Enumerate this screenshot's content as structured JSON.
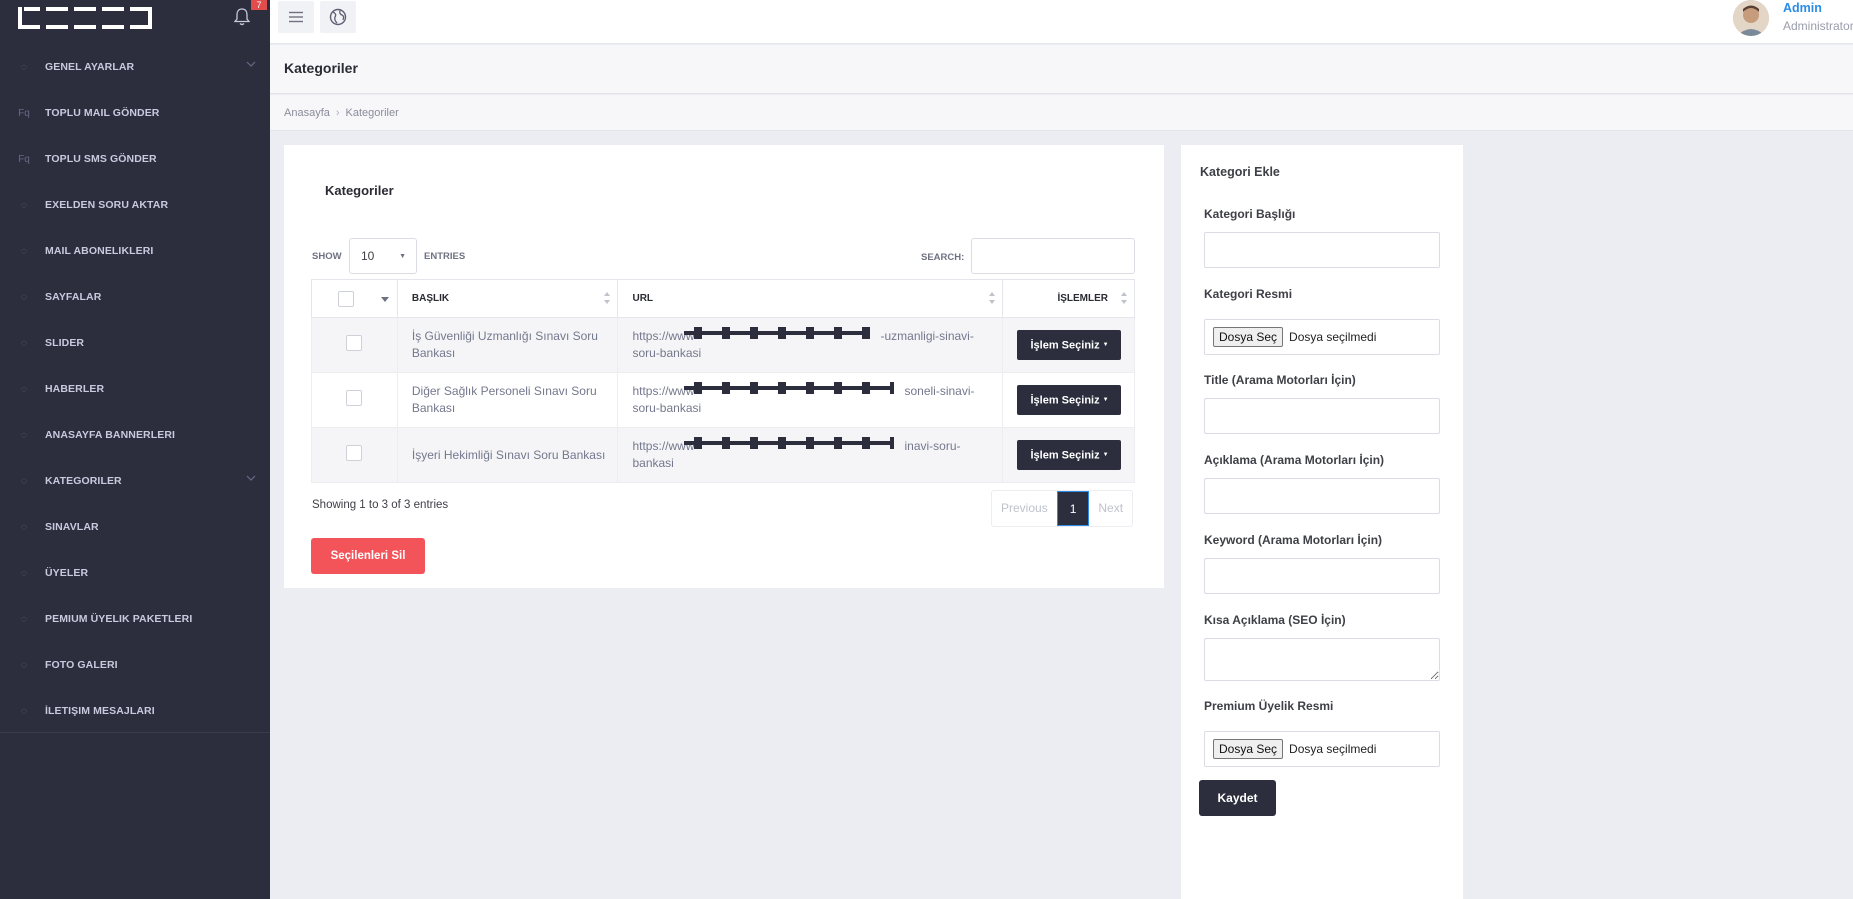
{
  "notifications": {
    "count": "7"
  },
  "sidebar": {
    "items": [
      {
        "label": "GENEL AYARLAR",
        "icon": "circle-icon",
        "glyph": "◌",
        "has_submenu": true
      },
      {
        "label": "TOPLU MAIL GÖNDER",
        "icon": "fq-icon",
        "glyph": "Fq",
        "has_submenu": false
      },
      {
        "label": "TOPLU SMS GÖNDER",
        "icon": "fq-icon",
        "glyph": "Fq",
        "has_submenu": false
      },
      {
        "label": "EXELDEN SORU AKTAR",
        "icon": "circle-icon",
        "glyph": "◌",
        "has_submenu": false
      },
      {
        "label": "MAIL ABONELIKLERI",
        "icon": "circle-icon",
        "glyph": "◌",
        "has_submenu": false
      },
      {
        "label": "SAYFALAR",
        "icon": "circle-icon",
        "glyph": "◌",
        "has_submenu": false
      },
      {
        "label": "SLIDER",
        "icon": "circle-icon",
        "glyph": "◌",
        "has_submenu": false
      },
      {
        "label": "HABERLER",
        "icon": "circle-icon",
        "glyph": "◌",
        "has_submenu": false
      },
      {
        "label": "ANASAYFA BANNERLERI",
        "icon": "circle-icon",
        "glyph": "◌",
        "has_submenu": false
      },
      {
        "label": "KATEGORILER",
        "icon": "circle-icon",
        "glyph": "◌",
        "has_submenu": true
      },
      {
        "label": "SINAVLAR",
        "icon": "circle-icon",
        "glyph": "◌",
        "has_submenu": false
      },
      {
        "label": "ÜYELER",
        "icon": "circle-icon",
        "glyph": "◌",
        "has_submenu": false
      },
      {
        "label": "PEMIUM ÜYELIK PAKETLERI",
        "icon": "circle-icon",
        "glyph": "◌",
        "has_submenu": false
      },
      {
        "label": "FOTO GALERI",
        "icon": "circle-icon",
        "glyph": "◌",
        "has_submenu": false
      },
      {
        "label": "İLETIŞIM MESAJLARI",
        "icon": "circle-icon",
        "glyph": "◌",
        "has_submenu": false
      }
    ]
  },
  "user": {
    "name": "Admin",
    "role": "Administrator"
  },
  "page": {
    "title": "Kategoriler"
  },
  "breadcrumb": {
    "home": "Anasayfa",
    "sep": "›",
    "current": "Kategoriler"
  },
  "card": {
    "title": "Kategoriler",
    "show_label": "SHOW",
    "entries_value": "10",
    "entries_label": "ENTRIES",
    "search_label": "SEARCH:",
    "search_value": ""
  },
  "table": {
    "columns": {
      "title": "BAŞLIK",
      "url": "URL",
      "actions": "İŞLEMLER"
    },
    "rows": [
      {
        "title": "İş Güvenliği Uzmanlığı Sınavı Soru Bankası",
        "url_prefix": "https://www",
        "url_suffix": "-uzmanligi-sinavi-soru-bankasi",
        "action": "İşlem Seçiniz"
      },
      {
        "title": "Diğer Sağlık Personeli Sınavı Soru Bankası",
        "url_prefix": "https://www",
        "url_suffix": "soneli-sinavi-soru-bankasi",
        "action": "İşlem Seçiniz"
      },
      {
        "title": "İşyeri Hekimliği Sınavı Soru Bankası",
        "url_prefix": "https://www",
        "url_suffix": "inavi-soru-bankasi",
        "action": "İşlem Seçiniz"
      }
    ]
  },
  "footer": {
    "showing": "Showing 1 to 3 of 3 entries",
    "previous": "Previous",
    "page": "1",
    "next": "Next",
    "delete_selected": "Seçilenleri Sil"
  },
  "form": {
    "title": "Kategori Ekle",
    "fields": {
      "baslik": "Kategori Başlığı",
      "resim": "Kategori Resmi",
      "title_seo": "Title (Arama Motorları İçin)",
      "aciklama": "Açıklama (Arama Motorları İçin)",
      "keyword": "Keyword (Arama Motorları İçin)",
      "kisa": "Kısa Açıklama (SEO İçin)",
      "premium": "Premium Üyelik Resmi"
    },
    "file_button": "Dosya Seç",
    "file_none": "Dosya seçilmedi",
    "save": "Kaydet"
  }
}
